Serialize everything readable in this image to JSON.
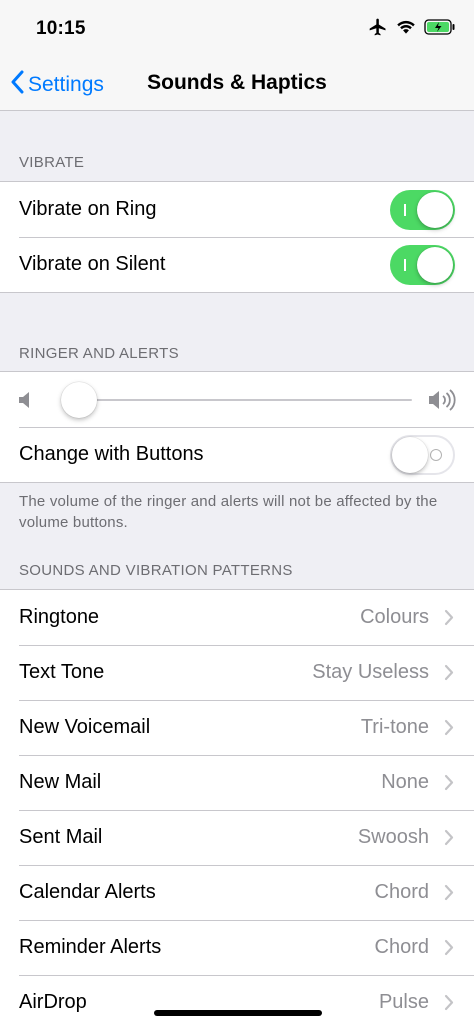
{
  "status_bar": {
    "time": "10:15",
    "icons": [
      "airplane-icon",
      "wifi-icon",
      "battery-charging-icon"
    ]
  },
  "nav": {
    "back_label": "Settings",
    "title": "Sounds & Haptics"
  },
  "vibrate": {
    "header": "VIBRATE",
    "rows": [
      {
        "label": "Vibrate on Ring",
        "on": true
      },
      {
        "label": "Vibrate on Silent",
        "on": true
      }
    ]
  },
  "ringer": {
    "header": "RINGER AND ALERTS",
    "volume_level": 0.0,
    "change_with_buttons": {
      "label": "Change with Buttons",
      "on": false
    },
    "note": "The volume of the ringer and alerts will not be affected by the volume buttons."
  },
  "sounds": {
    "header": "SOUNDS AND VIBRATION PATTERNS",
    "rows": [
      {
        "label": "Ringtone",
        "value": "Colours"
      },
      {
        "label": "Text Tone",
        "value": "Stay Useless"
      },
      {
        "label": "New Voicemail",
        "value": "Tri-tone"
      },
      {
        "label": "New Mail",
        "value": "None"
      },
      {
        "label": "Sent Mail",
        "value": "Swoosh"
      },
      {
        "label": "Calendar Alerts",
        "value": "Chord"
      },
      {
        "label": "Reminder Alerts",
        "value": "Chord"
      },
      {
        "label": "AirDrop",
        "value": "Pulse"
      }
    ]
  },
  "colors": {
    "accent": "#007aff",
    "toggle_on": "#4cd964",
    "secondary_text": "#8e8e93",
    "background": "#efeff4"
  }
}
